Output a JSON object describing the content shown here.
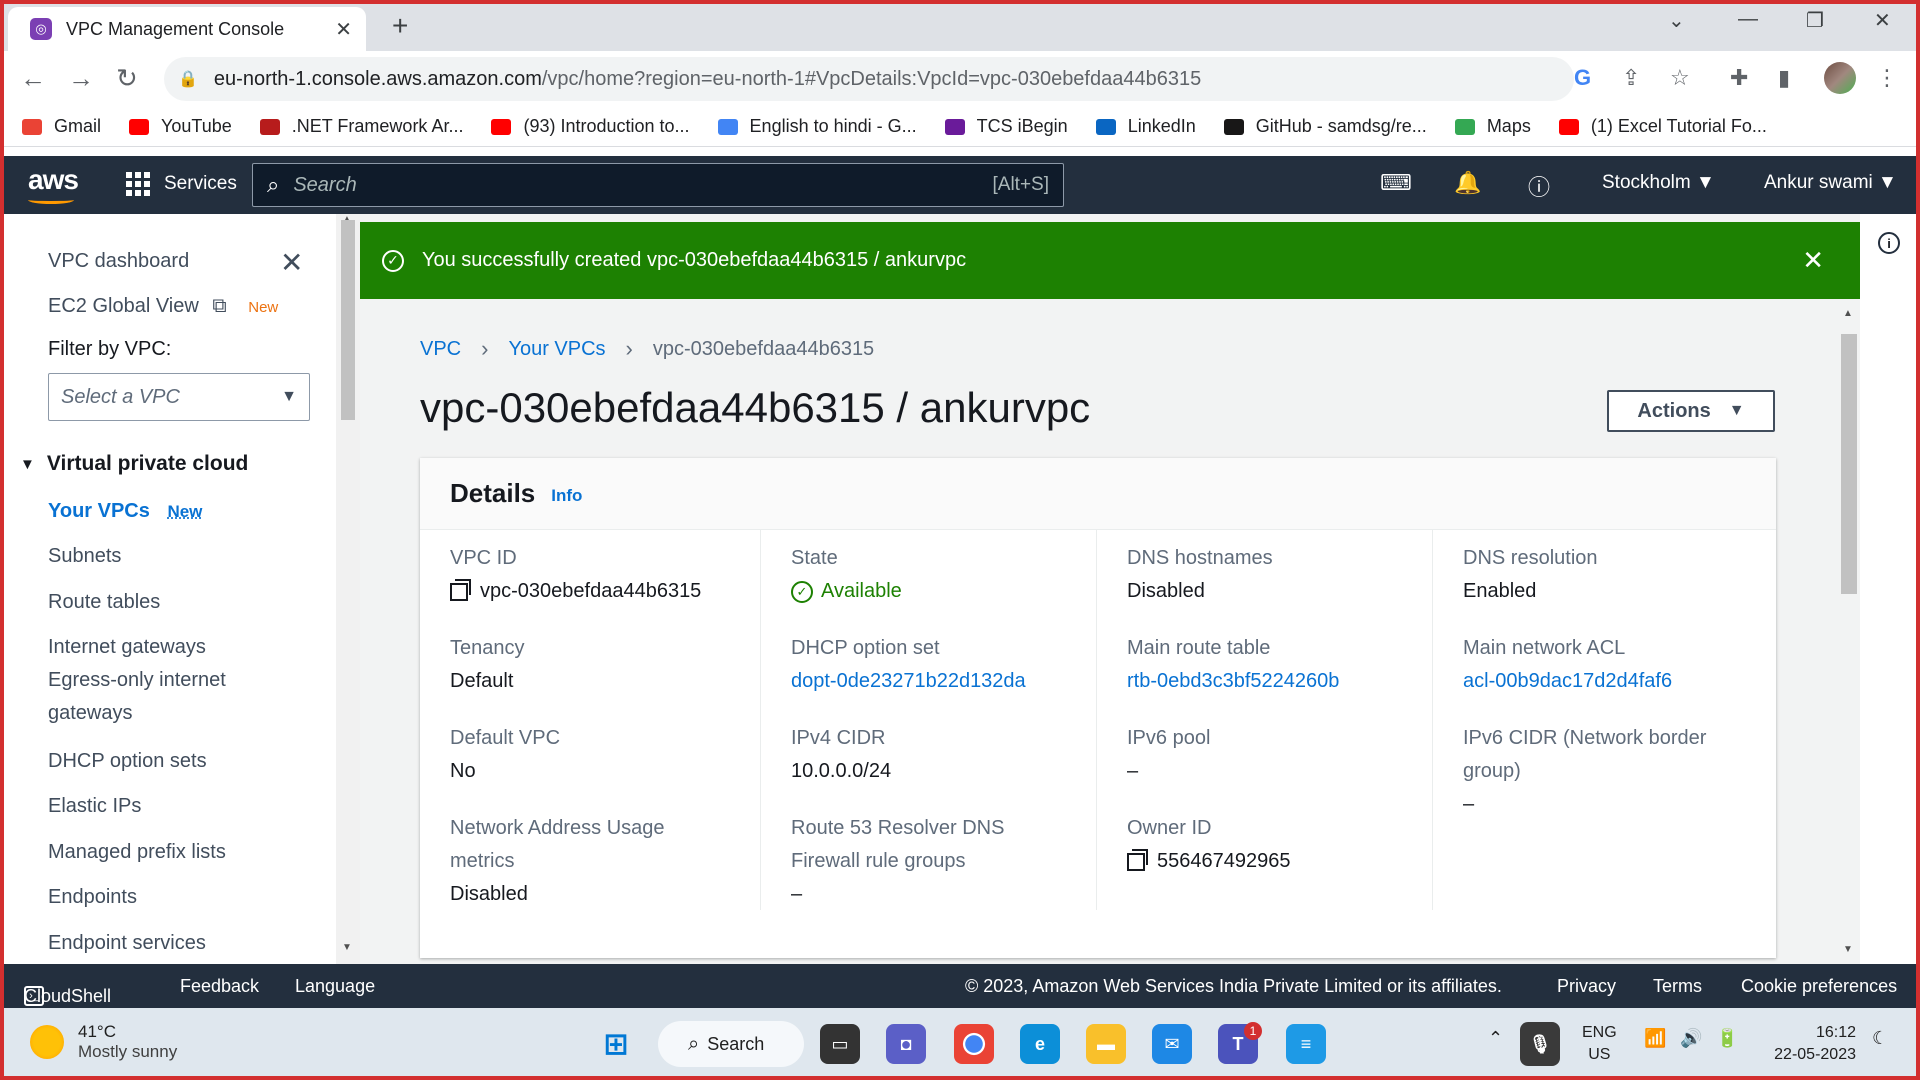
{
  "browser": {
    "tab_title": "VPC Management Console",
    "url_host": "eu-north-1.console.aws.amazon.com",
    "url_path": "/vpc/home?region=eu-north-1#VpcDetails:VpcId=vpc-030ebefdaa44b6315",
    "bookmarks": [
      {
        "label": "Gmail",
        "icon": "gmail-icon",
        "color": "#ea4335"
      },
      {
        "label": "YouTube",
        "icon": "youtube-icon",
        "color": "#ff0000"
      },
      {
        "label": ".NET Framework Ar...",
        "icon": "dotnet-icon",
        "color": "#b71c1c"
      },
      {
        "label": "(93) Introduction to...",
        "icon": "youtube-icon",
        "color": "#ff0000"
      },
      {
        "label": "English to hindi - G...",
        "icon": "google-icon",
        "color": "#4285f4"
      },
      {
        "label": "TCS iBegin",
        "icon": "tcs-icon",
        "color": "#6a1b9a"
      },
      {
        "label": "LinkedIn",
        "icon": "linkedin-icon",
        "color": "#0a66c2"
      },
      {
        "label": "GitHub - samdsg/re...",
        "icon": "github-icon",
        "color": "#181717"
      },
      {
        "label": "Maps",
        "icon": "maps-icon",
        "color": "#34a853"
      },
      {
        "label": "(1) Excel Tutorial Fo...",
        "icon": "youtube-icon",
        "color": "#ff0000"
      }
    ]
  },
  "aws_header": {
    "logo": "aws",
    "services": "Services",
    "search_placeholder": "Search",
    "search_shortcut": "[Alt+S]",
    "region": "Stockholm",
    "user": "Ankur swami"
  },
  "sidebar": {
    "dashboard": "VPC dashboard",
    "ec2_global": "EC2 Global View",
    "ec2_new": "New",
    "filter_label": "Filter by VPC:",
    "filter_placeholder": "Select a VPC",
    "section": "Virtual private cloud",
    "your_vpcs": "Your VPCs",
    "your_vpcs_new": "New",
    "items": [
      "Subnets",
      "Route tables",
      "Internet gateways",
      "Egress-only internet gateways",
      "DHCP option sets",
      "Elastic IPs",
      "Managed prefix lists",
      "Endpoints",
      "Endpoint services"
    ]
  },
  "flash": {
    "message": "You successfully created vpc-030ebefdaa44b6315 / ankurvpc",
    "color": "#1d8102"
  },
  "breadcrumb": [
    "VPC",
    "Your VPCs",
    "vpc-030ebefdaa44b6315"
  ],
  "page_title": "vpc-030ebefdaa44b6315 / ankurvpc",
  "actions_label": "Actions",
  "details": {
    "title": "Details",
    "info": "Info",
    "vpc_id_label": "VPC ID",
    "vpc_id": "vpc-030ebefdaa44b6315",
    "state_label": "State",
    "state": "Available",
    "dns_hostnames_label": "DNS hostnames",
    "dns_hostnames": "Disabled",
    "dns_resolution_label": "DNS resolution",
    "dns_resolution": "Enabled",
    "tenancy_label": "Tenancy",
    "tenancy": "Default",
    "dhcp_label": "DHCP option set",
    "dhcp": "dopt-0de23271b22d132da",
    "main_rt_label": "Main route table",
    "main_rt": "rtb-0ebd3c3bf5224260b",
    "main_acl_label": "Main network ACL",
    "main_acl": "acl-00b9dac17d2d4faf6",
    "default_vpc_label": "Default VPC",
    "default_vpc": "No",
    "ipv4_label": "IPv4 CIDR",
    "ipv4": "10.0.0.0/24",
    "ipv6pool_label": "IPv6 pool",
    "ipv6pool": "–",
    "ipv6cidr_label": "IPv6 CIDR (Network border group)",
    "ipv6cidr": "–",
    "nau_label": "Network Address Usage metrics",
    "nau": "Disabled",
    "r53_label": "Route 53 Resolver DNS Firewall rule groups",
    "r53": "–",
    "owner_label": "Owner ID",
    "owner": "556467492965"
  },
  "footer": {
    "cloudshell": "CloudShell",
    "feedback": "Feedback",
    "language": "Language",
    "copyright": "© 2023, Amazon Web Services India Private Limited or its affiliates.",
    "privacy": "Privacy",
    "terms": "Terms",
    "cookies": "Cookie preferences"
  },
  "taskbar": {
    "temp": "41°C",
    "weather": "Mostly sunny",
    "search": "Search",
    "lang1": "ENG",
    "lang2": "US",
    "time": "16:12",
    "date": "22-05-2023",
    "teams_badge": "1"
  }
}
